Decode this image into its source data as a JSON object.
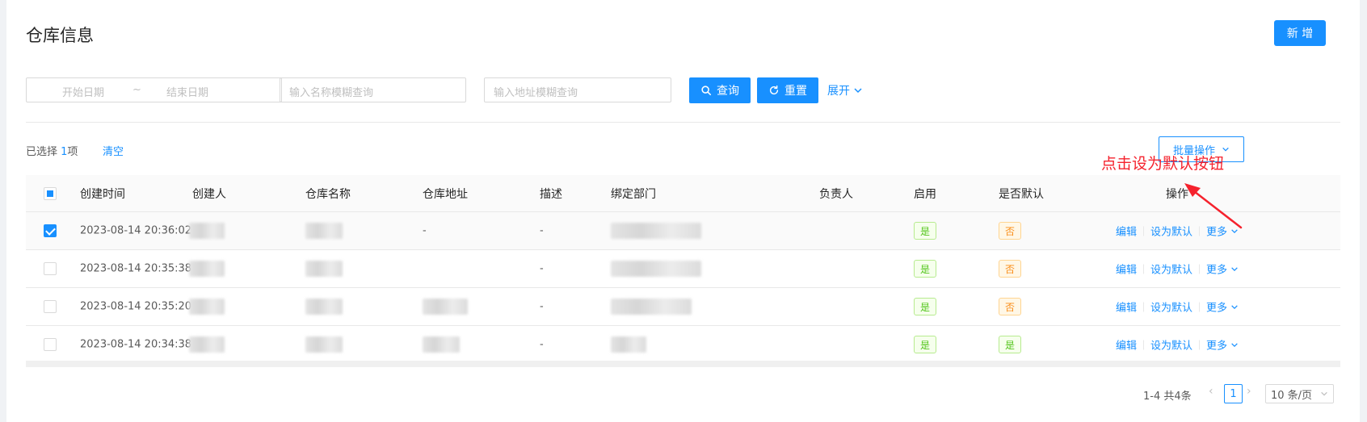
{
  "page": {
    "title": "仓库信息",
    "new_button": "新 增"
  },
  "filters": {
    "start_date_placeholder": "开始日期",
    "date_separator": "~",
    "end_date_placeholder": "结束日期",
    "name_placeholder": "输入名称模糊查询",
    "address_placeholder": "输入地址模糊查询",
    "search_button": "查询",
    "reset_button": "重置",
    "expand_link": "展开"
  },
  "selection": {
    "prefix": "已选择 ",
    "count": "1",
    "suffix": "项",
    "clear": "清空"
  },
  "batch_button": "批量操作",
  "annotation": "点击设为默认按钮",
  "table": {
    "columns": [
      "创建时间",
      "创建人",
      "仓库名称",
      "仓库地址",
      "描述",
      "绑定部门",
      "负责人",
      "启用",
      "是否默认",
      "操作"
    ],
    "rows": [
      {
        "created": "2023-08-14 20:36:02",
        "address": "-",
        "desc": "-",
        "enabled": "是",
        "default": "否",
        "checked": true
      },
      {
        "created": "2023-08-14 20:35:38",
        "address": "",
        "desc": "-",
        "enabled": "是",
        "default": "否",
        "checked": false
      },
      {
        "created": "2023-08-14 20:35:20",
        "address": "",
        "desc": "-",
        "enabled": "是",
        "default": "否",
        "checked": false
      },
      {
        "created": "2023-08-14 20:34:38",
        "address": "",
        "desc": "-",
        "enabled": "是",
        "default": "是",
        "checked": false
      }
    ],
    "actions": {
      "edit": "编辑",
      "set_default": "设为默认",
      "more": "更多"
    }
  },
  "pagination": {
    "total": "1-4 共4条",
    "current": "1",
    "page_size": "10 条/页"
  },
  "colors": {
    "primary": "#1890ff",
    "annotation": "#f5222d",
    "tag_green": "#52c41a",
    "tag_orange": "#fa8c16"
  }
}
